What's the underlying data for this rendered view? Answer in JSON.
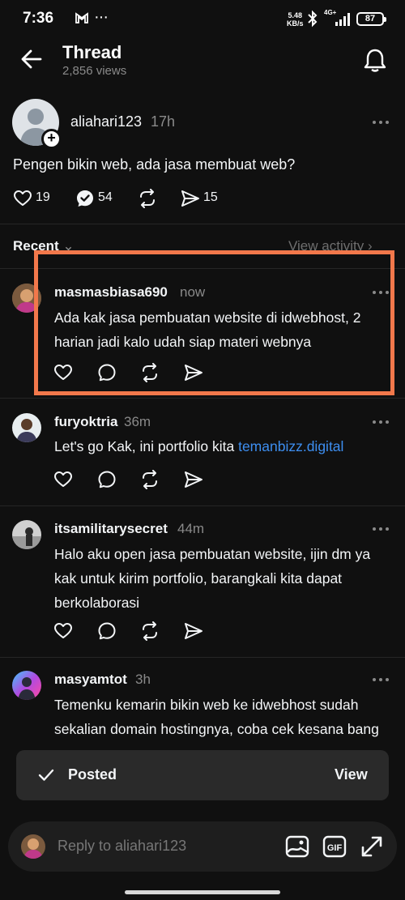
{
  "status_bar": {
    "time": "7:36",
    "net_speed": "5.48",
    "net_speed_unit": "KB/s",
    "network": "4G+",
    "battery": "87"
  },
  "header": {
    "title": "Thread",
    "views": "2,856 views"
  },
  "post": {
    "username": "aliahari123",
    "time": "17h",
    "text": "Pengen bikin web, ada jasa membuat web?",
    "likes": "19",
    "replies": "54",
    "shares": "15"
  },
  "sort": {
    "label": "Recent",
    "view_activity": "View activity"
  },
  "replies": [
    {
      "username": "masmasbiasa690",
      "time": "now",
      "text": "Ada kak jasa pembuatan website di idwebhost, 2 harian jadi kalo udah siap materi webnya"
    },
    {
      "username": "furyoktria",
      "time": "36m",
      "text": "Let's go Kak, ini portfolio kita ",
      "link": "temanbizz.digital"
    },
    {
      "username": "itsamilitarysecret",
      "time": "44m",
      "text": "Halo aku open jasa pembuatan website, ijin dm ya kak untuk kirim portfolio, barangkali kita dapat berkolaborasi"
    },
    {
      "username": "masyamtot",
      "time": "3h",
      "text": "Temenku kemarin bikin web ke idwebhost sudah sekalian domain hostingnya, coba cek kesana bang"
    }
  ],
  "toast": {
    "text": "Posted",
    "action": "View"
  },
  "reply_bar": {
    "placeholder": "Reply to aliahari123"
  },
  "colors": {
    "background": "#101010",
    "highlight": "#f2784b",
    "link": "#3d8ef0"
  },
  "icons": [
    "back-arrow-icon",
    "bell-icon",
    "heart-icon",
    "comment-icon",
    "repost-icon",
    "send-icon",
    "more-icon",
    "check-icon",
    "image-icon",
    "gif-icon",
    "expand-icon"
  ]
}
